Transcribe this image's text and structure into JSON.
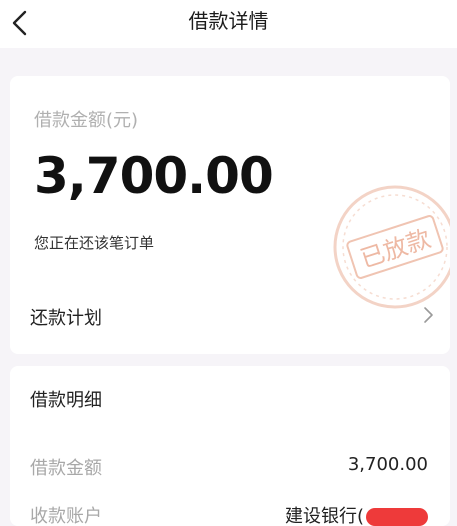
{
  "header": {
    "title": "借款详情"
  },
  "summary": {
    "amount_label": "借款金额(元)",
    "amount_value": "3,700.00",
    "status_text": "您正在还该笔订单",
    "stamp_text": "已放款"
  },
  "plan": {
    "label": "还款计划"
  },
  "details": {
    "title": "借款明细",
    "rows": [
      {
        "key": "借款金额",
        "value": "3,700.00"
      },
      {
        "key": "收款账户",
        "value": "建设银行("
      }
    ]
  },
  "colors": {
    "accent": "#ee3a3a",
    "stamp": "#f3c9b8"
  },
  "icons": {
    "back": "chevron-left-icon",
    "plan": "chevron-right-icon"
  }
}
